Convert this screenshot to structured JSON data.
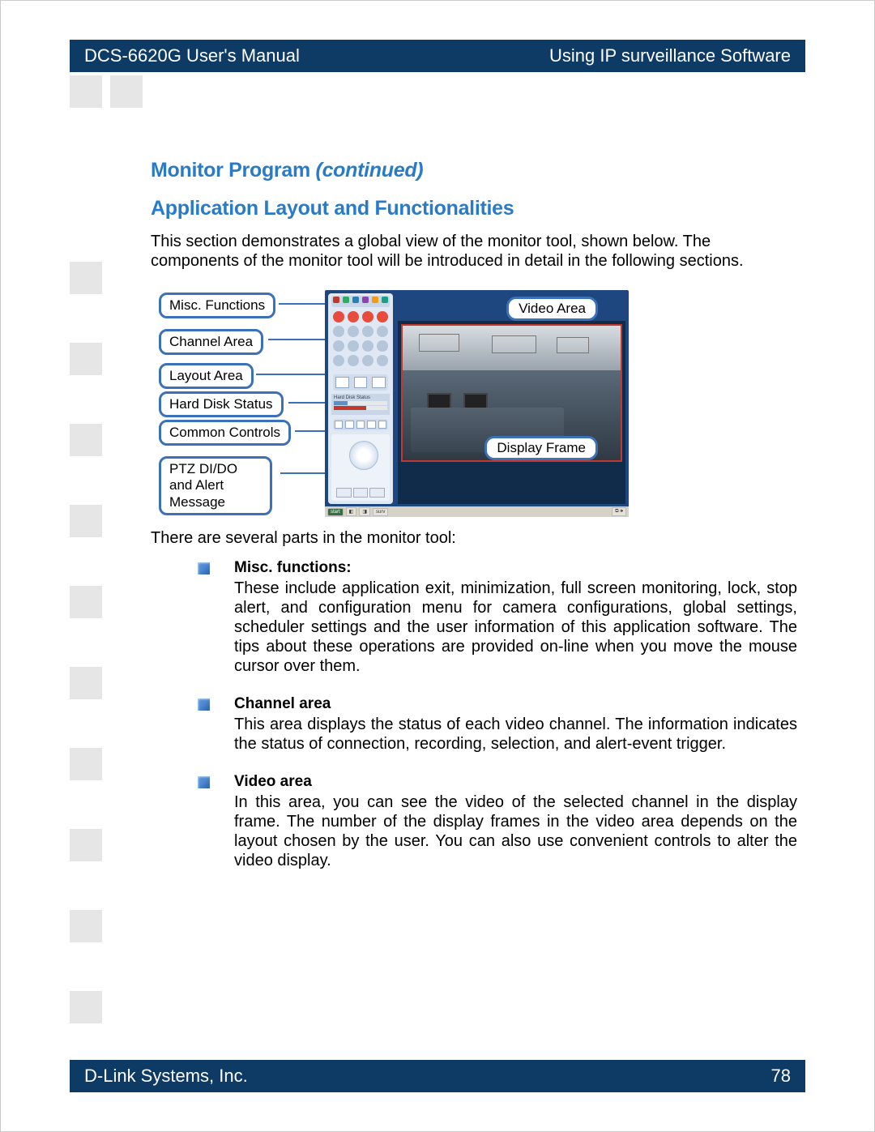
{
  "header": {
    "left": "DCS-6620G User's Manual",
    "right": "Using IP surveillance Software"
  },
  "footer": {
    "left": "D-Link Systems, Inc.",
    "page": "78"
  },
  "headings": {
    "h1a": "Monitor Program ",
    "h1b": "(continued)",
    "h2": "Application Layout and Functionalities"
  },
  "intro": "This section demonstrates a global view of the monitor tool, shown below. The components of the monitor tool will be introduced in detail in the following sections.",
  "callouts": {
    "misc": "Misc. Functions",
    "channel": "Channel Area",
    "layout": "Layout Area",
    "hdd": "Hard Disk Status",
    "common": "Common Controls",
    "ptz": "PTZ DI/DO and Alert Message",
    "video": "Video  Area",
    "display": "Display Frame"
  },
  "para2": "There are several parts in the monitor tool:",
  "sections": {
    "misc": {
      "title": "Misc. functions:",
      "body": "These include application exit, minimization, full screen monitoring, lock, stop alert, and configuration menu for camera configurations, global settings, scheduler settings and the user information of this application software. The tips about these operations are provided on-line when you move the mouse cursor over them."
    },
    "channel": {
      "title": "Channel area",
      "body": "This area displays the status of each video channel. The information indicates the status of connection, recording, selection, and alert-event trigger."
    },
    "video": {
      "title": "Video area",
      "body": "In this area, you can see the video of the selected channel in the display frame. The number of the display frames in the video area depends on the layout chosen by the user. You can also use convenient controls to alter the video display."
    }
  }
}
